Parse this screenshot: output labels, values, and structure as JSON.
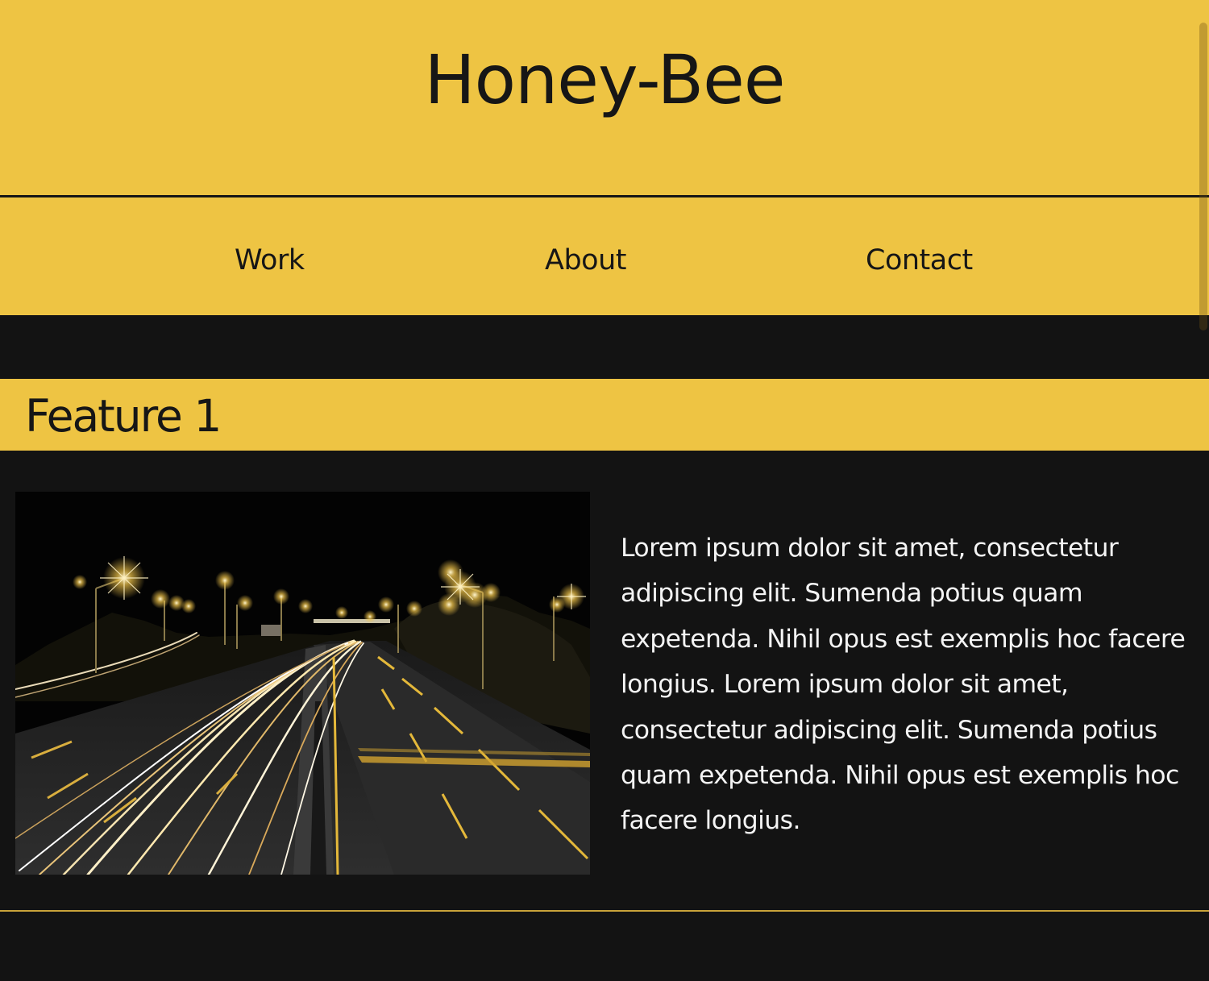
{
  "header": {
    "title": "Honey-Bee"
  },
  "nav": {
    "items": [
      {
        "label": "Work"
      },
      {
        "label": "About"
      },
      {
        "label": "Contact"
      }
    ]
  },
  "feature": {
    "title": "Feature 1",
    "image_subject": "highway-at-night-light-trails",
    "body": "Lorem ipsum dolor sit amet, consectetur adipiscing elit. Sumenda potius quam expetenda. Nihil opus est exemplis hoc facere longius. Lorem ipsum dolor sit amet, consectetur adipiscing elit. Sumenda potius quam expetenda. Nihil opus est exemplis hoc facere longius."
  },
  "colors": {
    "accent": "#EEC443",
    "background": "#131313",
    "text_dark": "#161616",
    "text_light": "#F4F4F4",
    "footer_line": "#C9A33A"
  }
}
